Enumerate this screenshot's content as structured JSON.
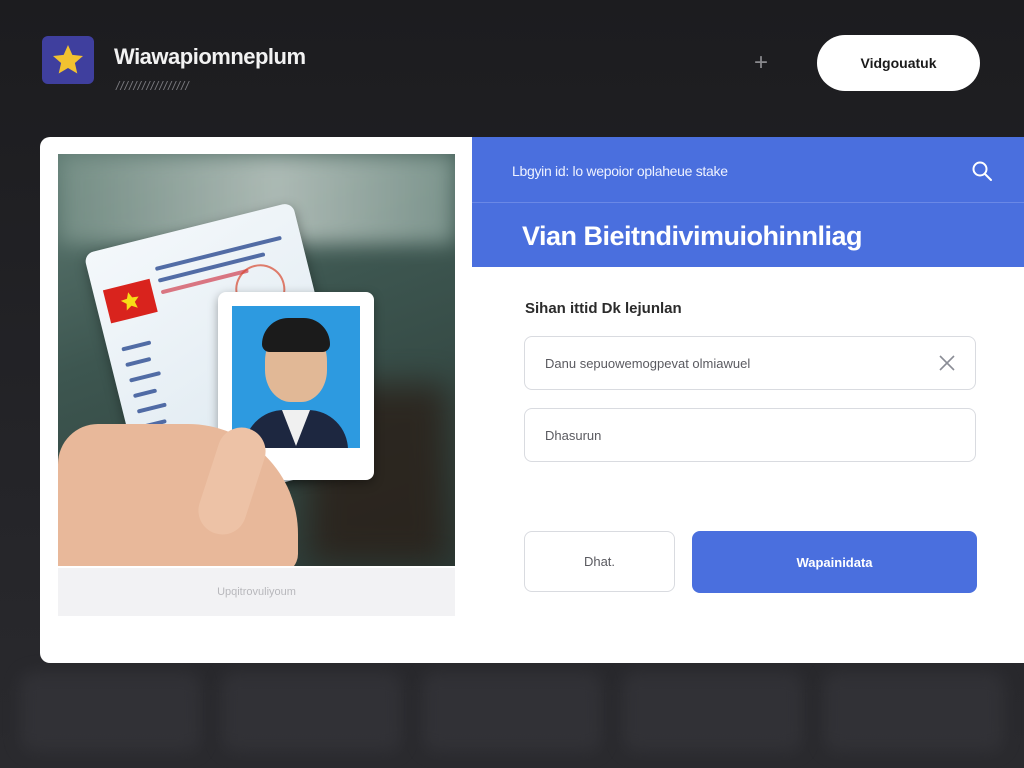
{
  "app": {
    "title": "Wiawapiomneplum",
    "subtitle": "/////////////////",
    "logo_icon": "star-icon",
    "plus_label": "+",
    "top_button_label": "Vidgouatuk"
  },
  "photo_panel": {
    "caption": "Upqitrovuliyoum",
    "image_description_icon": "id-card-photo"
  },
  "form": {
    "breadcrumb": "Lbgyin id: lo wepoior oplaheue stake",
    "heading": "Vian Bieitndivimuiohinnliag",
    "field_label": "Sihan ittid Dk lejunlan",
    "input1_value": "Danu sepuowemogpevat olmiawuel",
    "input2_value": "Dhasurun",
    "cancel_label": "Dhat.",
    "submit_label": "Wapainidata"
  },
  "colors": {
    "accent": "#4a6fde",
    "background": "#1f1f22",
    "logo_bg": "#3f3f9e",
    "star": "#f2c230"
  }
}
